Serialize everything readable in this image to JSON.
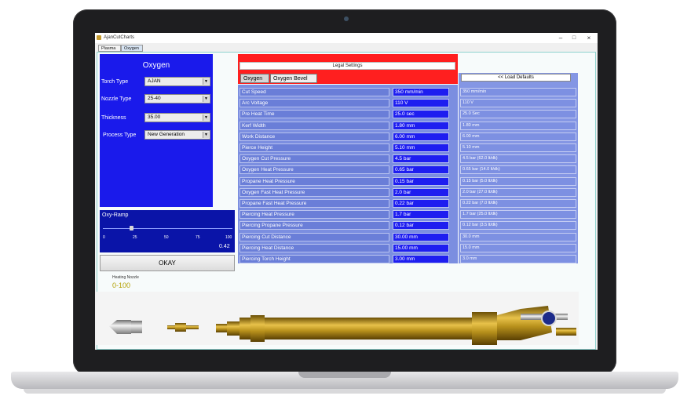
{
  "window": {
    "title": "AjanCutCharts",
    "controls": {
      "minimize": "–",
      "maximize": "□",
      "close": "×"
    }
  },
  "tabs": [
    {
      "label": "Plasma"
    },
    {
      "label": "Oxygen"
    }
  ],
  "left_panel": {
    "title": "Oxygen",
    "torch_type": {
      "label": "Torch Type",
      "value": "AJAN"
    },
    "nozzle_type": {
      "label": "Nozzle Type",
      "value": "25-40"
    },
    "thickness": {
      "label": "Thickness",
      "value": "35.00"
    },
    "process_type": {
      "label": "Process Type",
      "value": "New Generation"
    }
  },
  "oxy_ramp": {
    "label": "Oxy-Ramp",
    "ticks": [
      "0",
      "25",
      "50",
      "75",
      "100"
    ],
    "slider_position": 0.22,
    "value": "0.42"
  },
  "okay_button": {
    "label": "OKAY"
  },
  "legal": {
    "header": "Legal Settings",
    "subtabs": [
      {
        "label": "Oxygen"
      },
      {
        "label": "Oxygen Bevel"
      }
    ]
  },
  "load_defaults": {
    "label": "<< Load Defaults"
  },
  "rows": [
    {
      "label": "Cut Speed",
      "value": "350 mm/min",
      "default": "350 mm/min"
    },
    {
      "label": "Arc Voltage",
      "value": "110 V",
      "default": "110 V"
    },
    {
      "label": "Pre Heat Time",
      "value": "25.0 sec",
      "default": "25.0 Sec"
    },
    {
      "label": "Kerf Width",
      "value": "1.80 mm",
      "default": "1.80 mm"
    },
    {
      "label": "Work Distance",
      "value": "6.00 mm",
      "default": "6.00 mm"
    },
    {
      "label": "Pierce Height",
      "value": "5.10 mm",
      "default": "5.10 mm"
    },
    {
      "label": "Oxygen Cut Pressure",
      "value": "4.5 bar",
      "default": "4.5 bar (62.0 lt/dk)"
    },
    {
      "label": "Oxygen Heat Pressure",
      "value": "0.65 bar",
      "default": "0.65 bar (14.0 lt/dk)"
    },
    {
      "label": "Propane Heat Pressure",
      "value": "0.15 bar",
      "default": "0.15 bar (5.0 lt/dk)"
    },
    {
      "label": "Oxygen Fast Heat Pressure",
      "value": "2.0 bar",
      "default": "2.0 bar (27.0 lt/dk)"
    },
    {
      "label": "Propane Fast Heat Pressure",
      "value": "0.22 bar",
      "default": "0.22 bar (7.0 lt/dk)"
    },
    {
      "label": "Piercing Heat Pressure",
      "value": "1.7 bar",
      "default": "1.7 bar (25.0 lt/dk)"
    },
    {
      "label": "Piercing Propane Pressure",
      "value": "0.12 bar",
      "default": "0.12 bar (3.5 lt/dk)"
    },
    {
      "label": "Piercing Cut Distance",
      "value": "30.00 mm",
      "default": "30.0 mm"
    },
    {
      "label": "Piercing Heat Distance",
      "value": "15.00 mm",
      "default": "15.0 mm"
    },
    {
      "label": "Piercing Torch Height",
      "value": "3.00 mm",
      "default": "3.0 mm"
    }
  ],
  "heating_nozzle": {
    "label": "Heating Nozzle",
    "value": "0-100"
  },
  "icons": {
    "app": "torch-icon",
    "dropdown": "chevron-down-icon"
  }
}
